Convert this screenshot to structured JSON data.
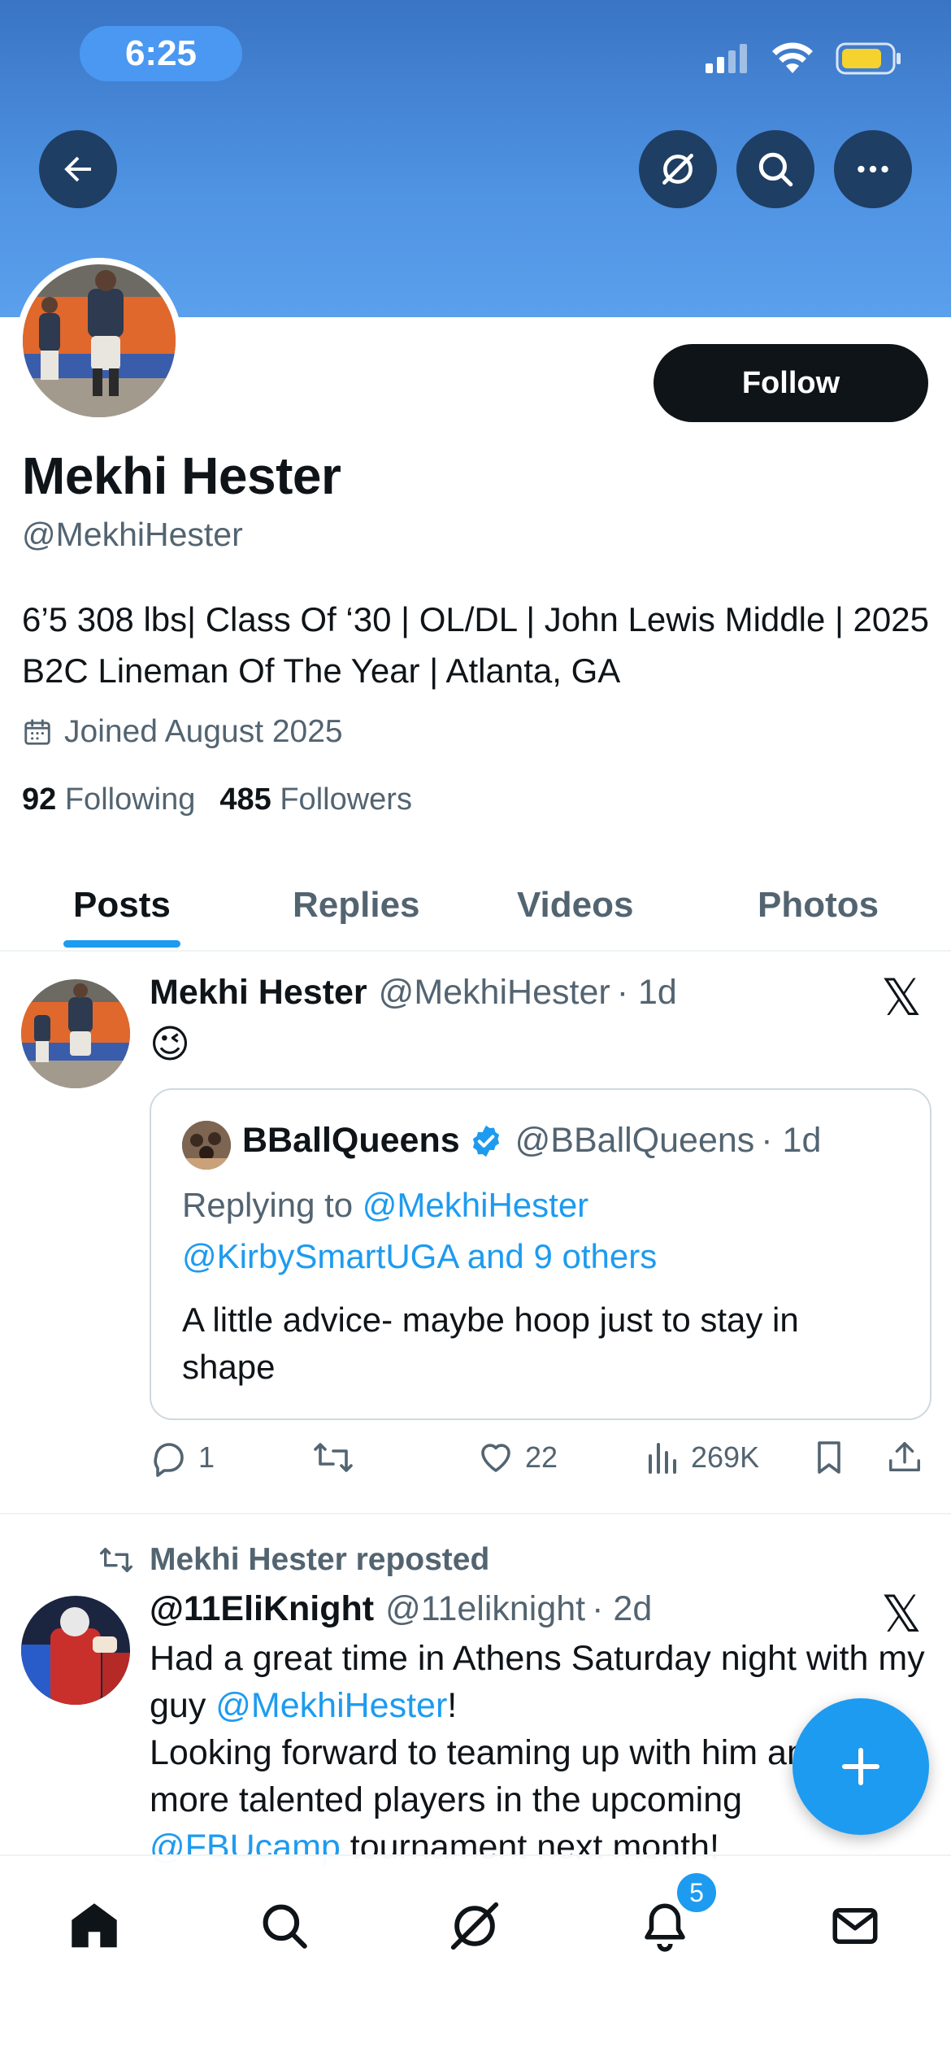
{
  "status_bar": {
    "time": "6:25"
  },
  "profile": {
    "name": "Mekhi Hester",
    "handle": "@MekhiHester",
    "bio": "6’5 308 lbs| Class Of ‘30 | OL/DL | John Lewis Middle | 2025 B2C Lineman Of The Year | Atlanta, GA",
    "joined": "Joined August 2025",
    "following_count": "92",
    "following_label": "Following",
    "followers_count": "485",
    "followers_label": "Followers",
    "follow_button": "Follow"
  },
  "tabs": [
    {
      "label": "Posts",
      "active": true
    },
    {
      "label": "Replies",
      "active": false
    },
    {
      "label": "Videos",
      "active": false
    },
    {
      "label": "Photos",
      "active": false
    }
  ],
  "post1": {
    "author": "Mekhi Hester",
    "handle": "@MekhiHester",
    "time": "· 1d",
    "text": "😉",
    "quote": {
      "author": "BBallQueens",
      "handle": "@BBallQueens",
      "time": "· 1d",
      "replying_prefix": "Replying to",
      "replying_to_1": "@MekhiHester",
      "replying_to_2": "@KirbySmartUGA and 9 others",
      "text": "A little advice- maybe hoop just to stay in shape"
    },
    "replies": "1",
    "reposts": "",
    "likes": "22",
    "views": "269K"
  },
  "post2": {
    "repost_label": "Mekhi Hester reposted",
    "author": "@11EliKnight",
    "handle": "@11eliknight",
    "time": "· 2d",
    "line1": "Had a great time in Athens Saturday night with my guy ",
    "mention1": "@MekhiHester",
    "line1_end": "!",
    "line2": "Looking forward to teaming up with him and many more talented players in the upcoming",
    "mention2": "@FBUcamp",
    "line3": " tournament next month!"
  },
  "nav": {
    "notifications_badge": "5"
  },
  "x_logo": "𝕏",
  "colors": {
    "accent": "#1d9bf0",
    "banner": "#4f93e3",
    "text": "#0f1419",
    "muted": "#536471"
  }
}
